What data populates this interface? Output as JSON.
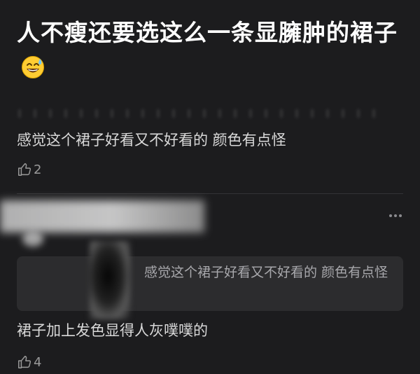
{
  "post": {
    "title": "人不瘦还要选这么一条显臃肿的裙子",
    "emoji": "grinning-face-with-sweat-icon"
  },
  "comments": [
    {
      "text": "感觉这个裙子好看又不好看的  颜色有点怪",
      "likes": "2"
    },
    {
      "quote": "感觉这个裙子好看又不好看的  颜色有点怪",
      "text": "裙子加上发色显得人灰噗噗的",
      "likes": "4"
    }
  ],
  "colors": {
    "background": "#1c1c1e",
    "quote_background": "#2c2c2e",
    "primary_text": "#ffffff",
    "secondary_text": "#d9d9d9",
    "muted_text": "#9a9a9a"
  }
}
